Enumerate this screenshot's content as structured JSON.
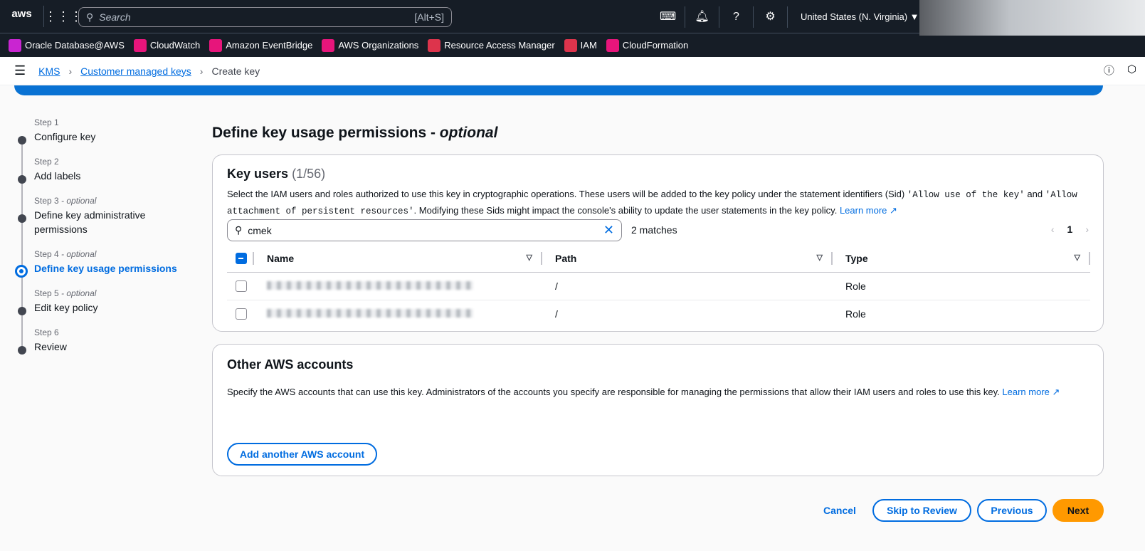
{
  "topbar": {
    "logo": "aws",
    "search_placeholder": "Search",
    "search_shortcut": "[Alt+S]",
    "region": "United States (N. Virginia) ▼",
    "icons": [
      "cloudshell-icon",
      "bell-icon",
      "help-icon",
      "gear-icon"
    ]
  },
  "favorites": [
    {
      "label": "Oracle Database@AWS",
      "color": "#c925d1"
    },
    {
      "label": "CloudWatch",
      "color": "#e7157b"
    },
    {
      "label": "Amazon EventBridge",
      "color": "#e7157b"
    },
    {
      "label": "AWS Organizations",
      "color": "#e7157b"
    },
    {
      "label": "Resource Access Manager",
      "color": "#dd344c"
    },
    {
      "label": "IAM",
      "color": "#dd344c"
    },
    {
      "label": "CloudFormation",
      "color": "#e7157b"
    }
  ],
  "breadcrumb": {
    "items": [
      "KMS",
      "Customer managed keys"
    ],
    "current": "Create key"
  },
  "steps": [
    {
      "num": "Step 1",
      "opt": "",
      "label": "Configure key"
    },
    {
      "num": "Step 2",
      "opt": "",
      "label": "Add labels"
    },
    {
      "num": "Step 3",
      "opt": " - optional",
      "label": "Define key administrative permissions"
    },
    {
      "num": "Step 4",
      "opt": " - optional",
      "label": "Define key usage permissions"
    },
    {
      "num": "Step 5",
      "opt": " - optional",
      "label": "Edit key policy"
    },
    {
      "num": "Step 6",
      "opt": "",
      "label": "Review"
    }
  ],
  "page": {
    "title": "Define key usage permissions - ",
    "title_em": "optional"
  },
  "key_users": {
    "title": "Key users",
    "count": "(1/56)",
    "desc1": "Select the IAM users and roles authorized to use this key in cryptographic operations. These users will be added to the key policy under the statement identifiers (Sid) ",
    "code1": "'Allow use of the key'",
    "desc2": " and ",
    "code2": "'Allow attachment of persistent resources'",
    "desc3": ". Modifying these Sids might impact the console's ability to update the user statements in the key policy. ",
    "learn_more": "Learn more ↗",
    "filter_value": "cmek",
    "matches": "2 matches",
    "page": "1",
    "columns": [
      "Name",
      "Path",
      "Type"
    ],
    "rows": [
      {
        "path": "/",
        "type": "Role"
      },
      {
        "path": "/",
        "type": "Role"
      }
    ]
  },
  "other_accounts": {
    "title": "Other AWS accounts",
    "desc": "Specify the AWS accounts that can use this key. Administrators of the accounts you specify are responsible for managing the permissions that allow their IAM users and roles to use this key. ",
    "learn_more": "Learn more ↗",
    "add_button": "Add another AWS account"
  },
  "footer": {
    "cancel": "Cancel",
    "skip": "Skip to Review",
    "previous": "Previous",
    "next": "Next"
  }
}
